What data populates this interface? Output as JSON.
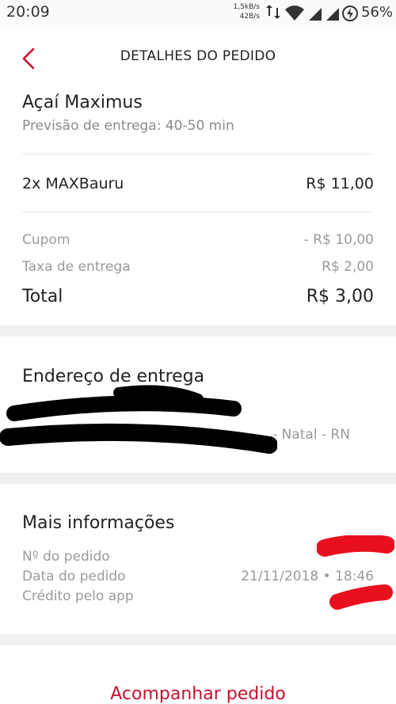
{
  "status_bar": {
    "time": "20:09",
    "net_up": "1,5kB/s",
    "net_down": "42B/s",
    "battery_pct": "56%"
  },
  "header": {
    "title": "DETALHES DO PEDIDO",
    "back_icon": "chevron-left-icon"
  },
  "order": {
    "store_name": "Açaí Maximus",
    "delivery_estimate": "Previsão de entrega: 40-50 min",
    "items": [
      {
        "label": "2x MAXBauru",
        "price": "R$ 11,00"
      }
    ],
    "coupon_label": "Cupom",
    "coupon_value": "- R$ 10,00",
    "fee_label": "Taxa de entrega",
    "fee_value": "R$ 2,00",
    "total_label": "Total",
    "total_value": "R$ 3,00"
  },
  "address": {
    "title": "Endereço de entrega",
    "line2_visible": "- Natal - RN"
  },
  "more_info": {
    "title": "Mais informações",
    "order_number_label": "Nº do pedido",
    "order_date_label": "Data do pedido",
    "order_date_value": "21/11/2018 • 18:46",
    "app_credit_label": "Crédito pelo app"
  },
  "actions": {
    "track_order": "Acompanhar pedido"
  },
  "colors": {
    "accent": "#c8102e",
    "muted_text": "#9a9a9a",
    "section_gap": "#f2f0ee"
  }
}
